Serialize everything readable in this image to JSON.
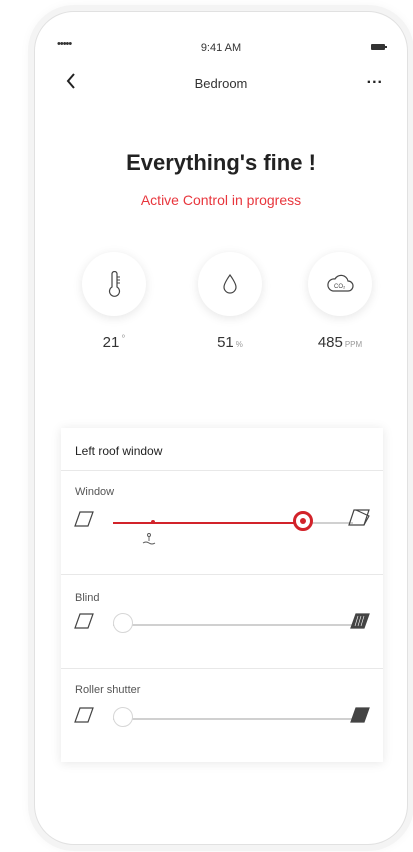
{
  "status_bar": {
    "signal": "•••••",
    "time": "9:41 AM"
  },
  "nav": {
    "back_icon": "chevron-left-icon",
    "title": "Bedroom",
    "more_label": "..."
  },
  "status": {
    "headline": "Everything's fine !",
    "subline": "Active Control in progress"
  },
  "metrics": [
    {
      "icon": "thermometer-icon",
      "value": "21",
      "unit": "°"
    },
    {
      "icon": "humidity-drop-icon",
      "value": "51",
      "unit": "%"
    },
    {
      "icon": "co2-cloud-icon",
      "value": "485",
      "unit": "PPM"
    }
  ],
  "device": {
    "title": "Left roof window",
    "controls": [
      {
        "label": "Window",
        "level": 0.82,
        "active": true,
        "marker": 0.16
      },
      {
        "label": "Blind",
        "level": 0.0,
        "active": false
      },
      {
        "label": "Roller shutter",
        "level": 0.0,
        "active": false
      }
    ]
  },
  "colors": {
    "accent": "#d2232a",
    "accent_text": "#e8363d"
  }
}
